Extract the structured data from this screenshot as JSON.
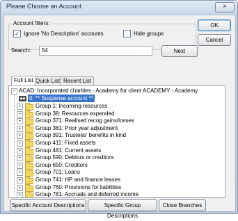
{
  "window": {
    "title": "Please Choose an Account",
    "close_glyph": "×"
  },
  "filters": {
    "legend": "Account filters:",
    "ignore_no_desc": {
      "label": "Ignore 'No Description' accounts",
      "checked": true
    },
    "hide_groups": {
      "label": "Hide groups",
      "checked": false
    }
  },
  "buttons": {
    "ok": "OK",
    "cancel": "Cancel",
    "next": "Next",
    "specific_account": "Specific Account Descriptions",
    "specific_group": "Specific Group Descriptions",
    "close_branches": "Close Branches"
  },
  "search": {
    "label": "Search:",
    "value": "54"
  },
  "tabs": [
    "Full List",
    "Quick List",
    "Recent List"
  ],
  "tree": {
    "root": "ACAD: Incorporated charities - Academy for client ACADEMY - Academy",
    "selected": "0: ** Suspense account **",
    "groups": [
      "Group 1: Incoming resources",
      "Group 38: Resources expended",
      "Group 371: Realised recog gains/losses",
      "Group 381: Prior year adjustment",
      "Group 391: Trustees' benefits in kind",
      "Group 411: Fixed assets",
      "Group 481: Current assets",
      "Group 590: Debtors or creditors",
      "Group 650: Creditors",
      "Group 701: Loans",
      "Group 741: HP and finance leases",
      "Group 760: Provisions for liabilities",
      "Group 781: Accruals and deferred income"
    ]
  },
  "colors": {
    "selection": "#3a74c9",
    "folder": "#f3d566"
  }
}
